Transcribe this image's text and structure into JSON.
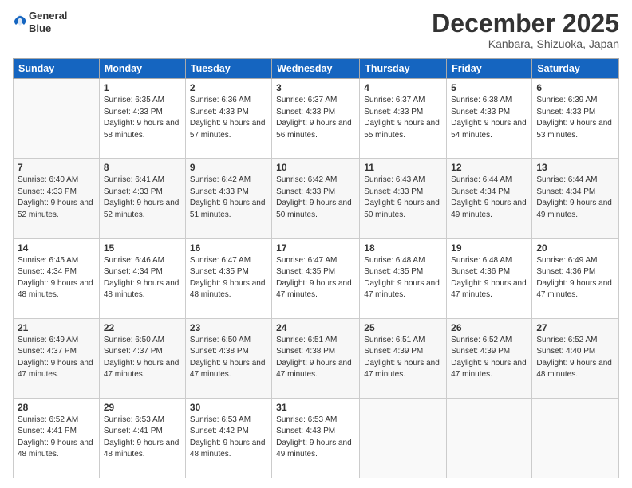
{
  "header": {
    "logo_line1": "General",
    "logo_line2": "Blue",
    "month_title": "December 2025",
    "location": "Kanbara, Shizuoka, Japan"
  },
  "columns": [
    "Sunday",
    "Monday",
    "Tuesday",
    "Wednesday",
    "Thursday",
    "Friday",
    "Saturday"
  ],
  "weeks": [
    [
      {
        "day": "",
        "sunrise": "",
        "sunset": "",
        "daylight": ""
      },
      {
        "day": "1",
        "sunrise": "Sunrise: 6:35 AM",
        "sunset": "Sunset: 4:33 PM",
        "daylight": "Daylight: 9 hours and 58 minutes."
      },
      {
        "day": "2",
        "sunrise": "Sunrise: 6:36 AM",
        "sunset": "Sunset: 4:33 PM",
        "daylight": "Daylight: 9 hours and 57 minutes."
      },
      {
        "day": "3",
        "sunrise": "Sunrise: 6:37 AM",
        "sunset": "Sunset: 4:33 PM",
        "daylight": "Daylight: 9 hours and 56 minutes."
      },
      {
        "day": "4",
        "sunrise": "Sunrise: 6:37 AM",
        "sunset": "Sunset: 4:33 PM",
        "daylight": "Daylight: 9 hours and 55 minutes."
      },
      {
        "day": "5",
        "sunrise": "Sunrise: 6:38 AM",
        "sunset": "Sunset: 4:33 PM",
        "daylight": "Daylight: 9 hours and 54 minutes."
      },
      {
        "day": "6",
        "sunrise": "Sunrise: 6:39 AM",
        "sunset": "Sunset: 4:33 PM",
        "daylight": "Daylight: 9 hours and 53 minutes."
      }
    ],
    [
      {
        "day": "7",
        "sunrise": "Sunrise: 6:40 AM",
        "sunset": "Sunset: 4:33 PM",
        "daylight": "Daylight: 9 hours and 52 minutes."
      },
      {
        "day": "8",
        "sunrise": "Sunrise: 6:41 AM",
        "sunset": "Sunset: 4:33 PM",
        "daylight": "Daylight: 9 hours and 52 minutes."
      },
      {
        "day": "9",
        "sunrise": "Sunrise: 6:42 AM",
        "sunset": "Sunset: 4:33 PM",
        "daylight": "Daylight: 9 hours and 51 minutes."
      },
      {
        "day": "10",
        "sunrise": "Sunrise: 6:42 AM",
        "sunset": "Sunset: 4:33 PM",
        "daylight": "Daylight: 9 hours and 50 minutes."
      },
      {
        "day": "11",
        "sunrise": "Sunrise: 6:43 AM",
        "sunset": "Sunset: 4:33 PM",
        "daylight": "Daylight: 9 hours and 50 minutes."
      },
      {
        "day": "12",
        "sunrise": "Sunrise: 6:44 AM",
        "sunset": "Sunset: 4:34 PM",
        "daylight": "Daylight: 9 hours and 49 minutes."
      },
      {
        "day": "13",
        "sunrise": "Sunrise: 6:44 AM",
        "sunset": "Sunset: 4:34 PM",
        "daylight": "Daylight: 9 hours and 49 minutes."
      }
    ],
    [
      {
        "day": "14",
        "sunrise": "Sunrise: 6:45 AM",
        "sunset": "Sunset: 4:34 PM",
        "daylight": "Daylight: 9 hours and 48 minutes."
      },
      {
        "day": "15",
        "sunrise": "Sunrise: 6:46 AM",
        "sunset": "Sunset: 4:34 PM",
        "daylight": "Daylight: 9 hours and 48 minutes."
      },
      {
        "day": "16",
        "sunrise": "Sunrise: 6:47 AM",
        "sunset": "Sunset: 4:35 PM",
        "daylight": "Daylight: 9 hours and 48 minutes."
      },
      {
        "day": "17",
        "sunrise": "Sunrise: 6:47 AM",
        "sunset": "Sunset: 4:35 PM",
        "daylight": "Daylight: 9 hours and 47 minutes."
      },
      {
        "day": "18",
        "sunrise": "Sunrise: 6:48 AM",
        "sunset": "Sunset: 4:35 PM",
        "daylight": "Daylight: 9 hours and 47 minutes."
      },
      {
        "day": "19",
        "sunrise": "Sunrise: 6:48 AM",
        "sunset": "Sunset: 4:36 PM",
        "daylight": "Daylight: 9 hours and 47 minutes."
      },
      {
        "day": "20",
        "sunrise": "Sunrise: 6:49 AM",
        "sunset": "Sunset: 4:36 PM",
        "daylight": "Daylight: 9 hours and 47 minutes."
      }
    ],
    [
      {
        "day": "21",
        "sunrise": "Sunrise: 6:49 AM",
        "sunset": "Sunset: 4:37 PM",
        "daylight": "Daylight: 9 hours and 47 minutes."
      },
      {
        "day": "22",
        "sunrise": "Sunrise: 6:50 AM",
        "sunset": "Sunset: 4:37 PM",
        "daylight": "Daylight: 9 hours and 47 minutes."
      },
      {
        "day": "23",
        "sunrise": "Sunrise: 6:50 AM",
        "sunset": "Sunset: 4:38 PM",
        "daylight": "Daylight: 9 hours and 47 minutes."
      },
      {
        "day": "24",
        "sunrise": "Sunrise: 6:51 AM",
        "sunset": "Sunset: 4:38 PM",
        "daylight": "Daylight: 9 hours and 47 minutes."
      },
      {
        "day": "25",
        "sunrise": "Sunrise: 6:51 AM",
        "sunset": "Sunset: 4:39 PM",
        "daylight": "Daylight: 9 hours and 47 minutes."
      },
      {
        "day": "26",
        "sunrise": "Sunrise: 6:52 AM",
        "sunset": "Sunset: 4:39 PM",
        "daylight": "Daylight: 9 hours and 47 minutes."
      },
      {
        "day": "27",
        "sunrise": "Sunrise: 6:52 AM",
        "sunset": "Sunset: 4:40 PM",
        "daylight": "Daylight: 9 hours and 48 minutes."
      }
    ],
    [
      {
        "day": "28",
        "sunrise": "Sunrise: 6:52 AM",
        "sunset": "Sunset: 4:41 PM",
        "daylight": "Daylight: 9 hours and 48 minutes."
      },
      {
        "day": "29",
        "sunrise": "Sunrise: 6:53 AM",
        "sunset": "Sunset: 4:41 PM",
        "daylight": "Daylight: 9 hours and 48 minutes."
      },
      {
        "day": "30",
        "sunrise": "Sunrise: 6:53 AM",
        "sunset": "Sunset: 4:42 PM",
        "daylight": "Daylight: 9 hours and 48 minutes."
      },
      {
        "day": "31",
        "sunrise": "Sunrise: 6:53 AM",
        "sunset": "Sunset: 4:43 PM",
        "daylight": "Daylight: 9 hours and 49 minutes."
      },
      {
        "day": "",
        "sunrise": "",
        "sunset": "",
        "daylight": ""
      },
      {
        "day": "",
        "sunrise": "",
        "sunset": "",
        "daylight": ""
      },
      {
        "day": "",
        "sunrise": "",
        "sunset": "",
        "daylight": ""
      }
    ]
  ]
}
